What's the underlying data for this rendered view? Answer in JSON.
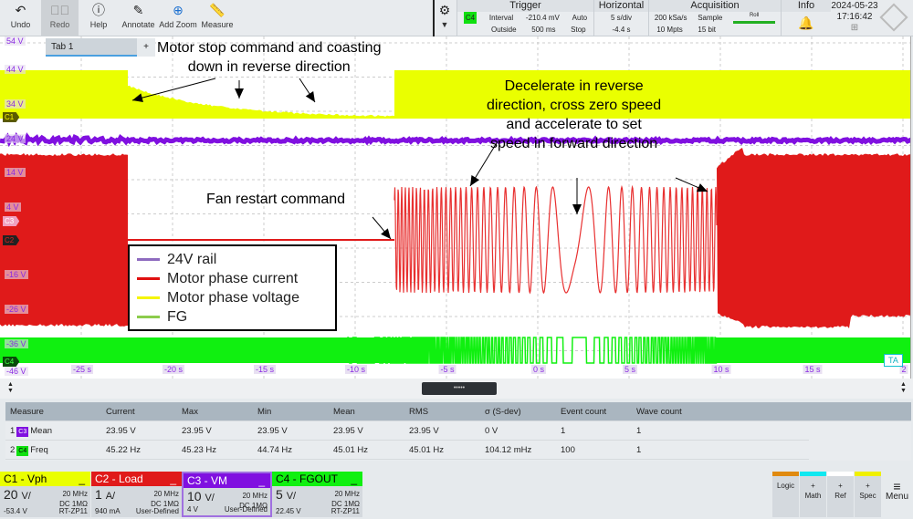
{
  "toolbar": {
    "undo": "Undo",
    "redo": "Redo",
    "help": "Help",
    "annotate": "Annotate",
    "add_zoom": "Add Zoom",
    "measure": "Measure"
  },
  "trigger": {
    "title": "Trigger",
    "source": "C4",
    "type": "Interval",
    "level": "-210.4 mV",
    "mode": "Auto",
    "condition": "Outside",
    "time": "500 ms",
    "state": "Stop"
  },
  "horizontal": {
    "title": "Horizontal",
    "scale": "5 s/div",
    "position": "-4.4 s"
  },
  "acquisition": {
    "title": "Acquisition",
    "rate": "200 kSa/s",
    "mode": "Sample",
    "roll": "Roll",
    "points": "10 Mpts",
    "resolution": "15 bit"
  },
  "info": {
    "title": "Info"
  },
  "datetime": {
    "date": "2024-05-23",
    "time": "17:16:42"
  },
  "tab": {
    "label": "Tab 1",
    "add": "+"
  },
  "y_labels": [
    "54 V",
    "44 V",
    "34 V",
    "24 V",
    "14 V",
    "4 V",
    "-16 V",
    "-26 V",
    "-36 V",
    "-46 V"
  ],
  "x_labels": [
    "-25 s",
    "-20 s",
    "-15 s",
    "-10 s",
    "-5 s",
    "0 s",
    "5 s",
    "10 s",
    "15 s",
    "2"
  ],
  "markers": {
    "c1": "C1",
    "c2": "C2",
    "c3": "C3",
    "c4": "C4",
    "ta": "TA"
  },
  "annotations": {
    "stop": [
      "Motor stop command and coasting",
      "down in reverse direction"
    ],
    "restart": "Fan restart command",
    "decel": [
      "Decelerate in reverse",
      "direction, cross zero speed",
      "and accelerate to set",
      "speed in forward direction"
    ]
  },
  "legend": [
    {
      "label": "24V rail",
      "color": "#8e6bbf"
    },
    {
      "label": "Motor phase current",
      "color": "#e01010"
    },
    {
      "label": "Motor phase voltage",
      "color": "#f5f500"
    },
    {
      "label": "FG",
      "color": "#8ccc4c"
    }
  ],
  "colors": {
    "c1": "#eaff00",
    "c2": "#e01a1a",
    "c3": "#8010e0",
    "c4": "#10f010"
  },
  "splitter": {
    "handle": "•••••"
  },
  "measure_table": {
    "headers": [
      "Measure",
      "Current",
      "Max",
      "Min",
      "Mean",
      "RMS",
      "σ (S-dev)",
      "Event count",
      "Wave count"
    ],
    "rows": [
      {
        "index": "1",
        "source": "C3",
        "name": "Mean",
        "values": [
          "23.95 V",
          "23.95 V",
          "23.95 V",
          "23.95 V",
          "23.95 V",
          "0 V",
          "1",
          "1"
        ]
      },
      {
        "index": "2",
        "source": "C4",
        "name": "Freq",
        "values": [
          "45.22 Hz",
          "45.23 Hz",
          "44.74 Hz",
          "45.01 Hz",
          "45.01 Hz",
          "104.12 mHz",
          "100",
          "1"
        ]
      }
    ]
  },
  "channels": [
    {
      "name": "C1 - Vph",
      "scale": "20",
      "unit": "V/",
      "bw": "20 MHz",
      "coupling": "DC 1MΩ",
      "offset": "-53.4 V",
      "probe": "RT-ZP11",
      "min": "_"
    },
    {
      "name": "C2 - Load",
      "scale": "1",
      "unit": "A/",
      "bw": "20 MHz",
      "coupling": "DC 1MΩ",
      "offset": "940 mA",
      "probe": "User-Defined",
      "min": "_"
    },
    {
      "name": "C3 - VM",
      "scale": "10",
      "unit": "V/",
      "bw": "20 MHz",
      "coupling": "DC 1MΩ",
      "offset": "4 V",
      "probe": "User-Defined",
      "min": "_"
    },
    {
      "name": "C4 - FGOUT",
      "scale": "5",
      "unit": "V/",
      "bw": "20 MHz",
      "coupling": "DC 1MΩ",
      "offset": "22.45 V",
      "probe": "RT-ZP11",
      "min": "_"
    }
  ],
  "right_buttons": [
    {
      "plus": "",
      "label": "Logic",
      "color": "#e08a10"
    },
    {
      "plus": "+",
      "label": "Math",
      "color": "#10e8f0"
    },
    {
      "plus": "+",
      "label": "Ref",
      "color": "#ffffff"
    },
    {
      "plus": "+",
      "label": "Spec",
      "color": "#f0f000"
    }
  ],
  "menu": "Menu"
}
